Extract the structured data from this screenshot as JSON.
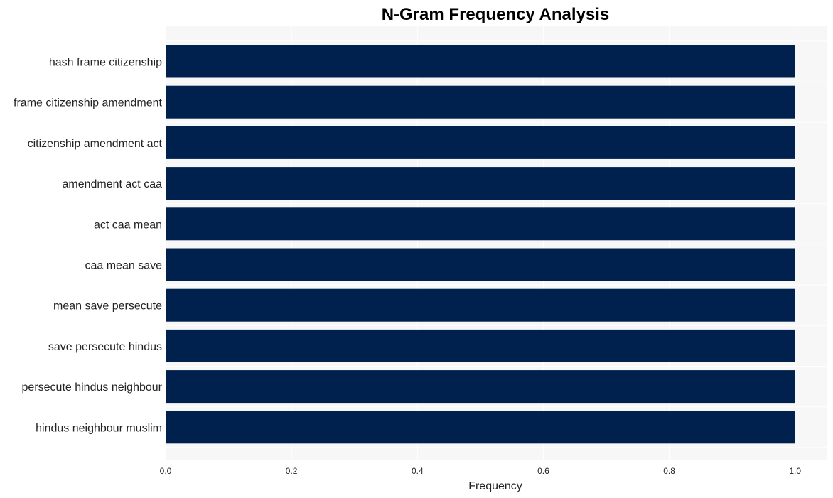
{
  "chart_data": {
    "type": "bar",
    "orientation": "horizontal",
    "title": "N-Gram Frequency Analysis",
    "xlabel": "Frequency",
    "ylabel": "",
    "categories": [
      "hash frame citizenship",
      "frame citizenship amendment",
      "citizenship amendment act",
      "amendment act caa",
      "act caa mean",
      "caa mean save",
      "mean save persecute",
      "save persecute hindus",
      "persecute hindus neighbour",
      "hindus neighbour muslim"
    ],
    "values": [
      1,
      1,
      1,
      1,
      1,
      1,
      1,
      1,
      1,
      1
    ],
    "xlim": [
      0,
      1.05
    ],
    "xticks": [
      "0.0",
      "0.2",
      "0.4",
      "0.6",
      "0.8",
      "1.0"
    ],
    "xtick_values": [
      0,
      0.2,
      0.4,
      0.6,
      0.8,
      1.0
    ],
    "grid": true,
    "legend": "none",
    "colors": {
      "bar": "#00204e",
      "plot_bg": "#f7f7f7",
      "grid": "#ffffff"
    }
  }
}
